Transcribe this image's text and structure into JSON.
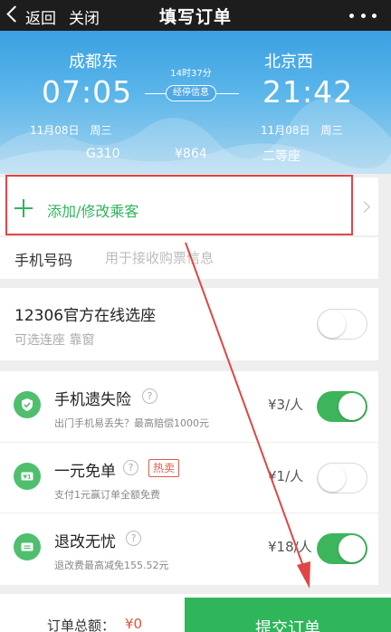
{
  "topbar": {
    "back_label": "返回",
    "close_label": "关闭",
    "title": "填写订单"
  },
  "ticket": {
    "from_station": "成都东",
    "to_station": "北京西",
    "depart_time": "07:05",
    "arrive_time": "21:42",
    "duration": "14时37分",
    "stops_button": "经停信息",
    "depart_date": "11月08日　周三",
    "arrive_date": "11月08日　周三",
    "train_no": "G310",
    "price": "¥864",
    "seat_class": "二等座"
  },
  "passenger": {
    "label": "添加/修改乘客"
  },
  "phone": {
    "label": "手机号码",
    "placeholder": "用于接收购票信息"
  },
  "seat_select": {
    "title": "12306官方在线选座",
    "subtitle": "可选连座 靠窗",
    "enabled": false
  },
  "insurance": [
    {
      "title": "手机遗失险",
      "desc": "出门手机易丢失？最高赔偿1000元",
      "price": "¥3/人",
      "enabled": true,
      "icon": "shield-icon"
    },
    {
      "title": "一元免单",
      "badge": "热卖",
      "desc": "支付1元赢订单全额免费",
      "price": "¥1/人",
      "enabled": false,
      "icon": "coupon-icon"
    },
    {
      "title": "退改无忧",
      "desc": "退改费最高减免155.52元",
      "price": "¥18/人",
      "enabled": true,
      "icon": "ticket-icon"
    }
  ],
  "bottom": {
    "total_label": "订单总额：",
    "total_value": "¥0",
    "submit_label": "提交订单"
  },
  "colors": {
    "accent_green": "#2fb55a",
    "header_blue": "#3aa0e2",
    "annotation_red": "#e04646"
  }
}
